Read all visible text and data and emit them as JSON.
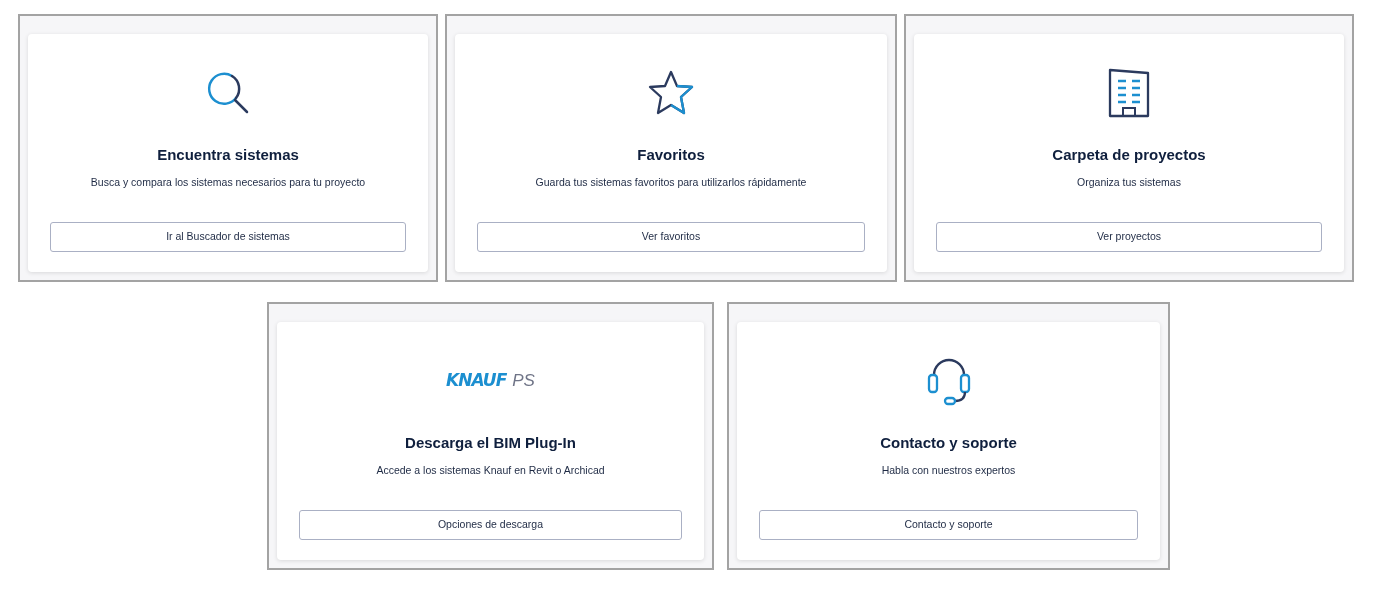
{
  "cards": [
    {
      "title": "Encuentra sistemas",
      "description": "Busca y compara los sistemas necesarios para tu proyecto",
      "button": "Ir al Buscador de sistemas"
    },
    {
      "title": "Favoritos",
      "description": "Guarda tus sistemas favoritos para utilizarlos rápidamente",
      "button": "Ver favoritos"
    },
    {
      "title": "Carpeta de proyectos",
      "description": "Organiza tus sistemas",
      "button": "Ver proyectos"
    },
    {
      "logo": {
        "brand": "KNAUF",
        "product": "PS"
      },
      "title": "Descarga el BIM Plug-In",
      "description": "Accede a los sistemas Knauf en Revit o Archicad",
      "button": "Opciones de descarga"
    },
    {
      "title": "Contacto y soporte",
      "description": "Habla con nuestros expertos",
      "button": "Contacto y soporte"
    }
  ]
}
